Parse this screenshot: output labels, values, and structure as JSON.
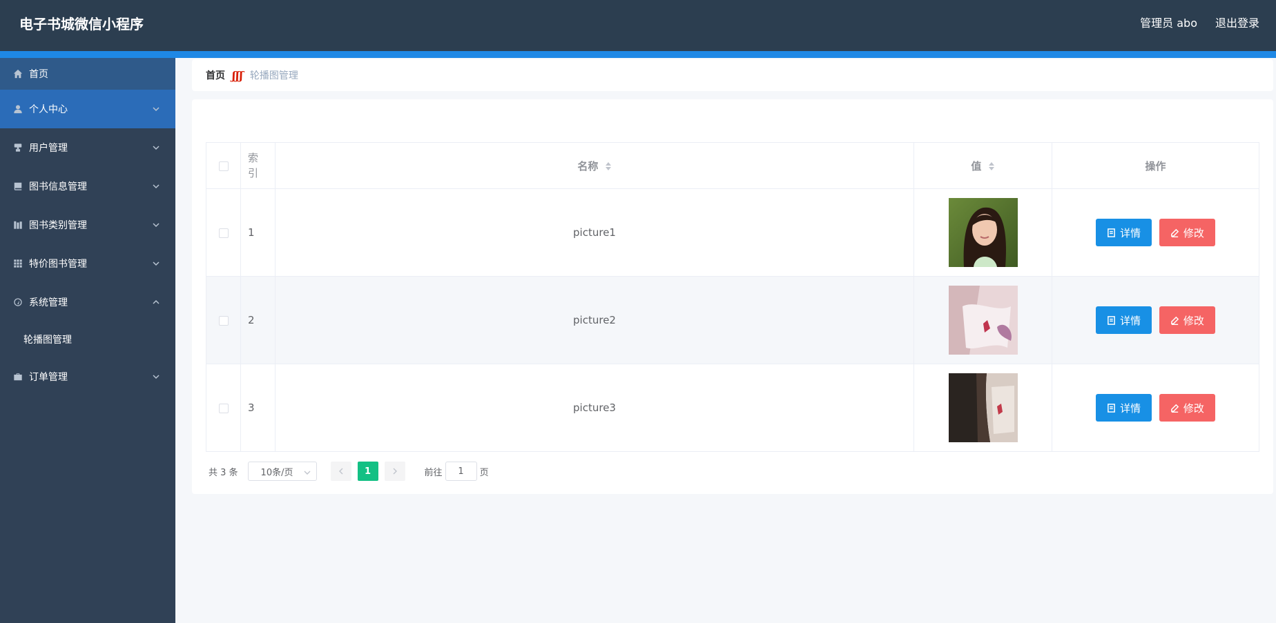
{
  "header": {
    "app_title": "电子书城微信小程序",
    "user_label": "管理员 abo",
    "logout_label": "退出登录"
  },
  "sidebar": {
    "items": [
      {
        "label": "首页",
        "icon": "home-icon"
      },
      {
        "label": "个人中心",
        "icon": "user-icon"
      },
      {
        "label": "用户管理",
        "icon": "user-manage-icon"
      },
      {
        "label": "图书信息管理",
        "icon": "book-icon"
      },
      {
        "label": "图书类别管理",
        "icon": "category-icon"
      },
      {
        "label": "特价图书管理",
        "icon": "grid-icon"
      },
      {
        "label": "系统管理",
        "icon": "gauge-icon"
      },
      {
        "label": "订单管理",
        "icon": "briefcase-icon"
      }
    ],
    "system_submenu": {
      "label": "轮播图管理"
    }
  },
  "breadcrumb": {
    "home": "首页",
    "separator": "ʃʃʃ",
    "current": "轮播图管理"
  },
  "table": {
    "headers": {
      "index": "索引",
      "name": "名称",
      "value": "值",
      "ops": "操作"
    },
    "rows": [
      {
        "index": "1",
        "name": "picture1",
        "thumb": "portrait-photo"
      },
      {
        "index": "2",
        "name": "picture2",
        "thumb": "book-pages-photo"
      },
      {
        "index": "3",
        "name": "picture3",
        "thumb": "dark-book-photo"
      }
    ],
    "detail_label": "详情",
    "edit_label": "修改"
  },
  "pagination": {
    "total": "共 3 条",
    "page_size": "10条/页",
    "current_page": "1",
    "goto_label": "前往",
    "goto_value": "1",
    "page_suffix": "页"
  },
  "colors": {
    "header_bg": "#2c3e50",
    "sidebar_bg": "#304156",
    "active_menu": "#2b6cb8",
    "detail_btn": "#1890e5",
    "edit_btn": "#f56464",
    "page_active": "#13c084"
  }
}
